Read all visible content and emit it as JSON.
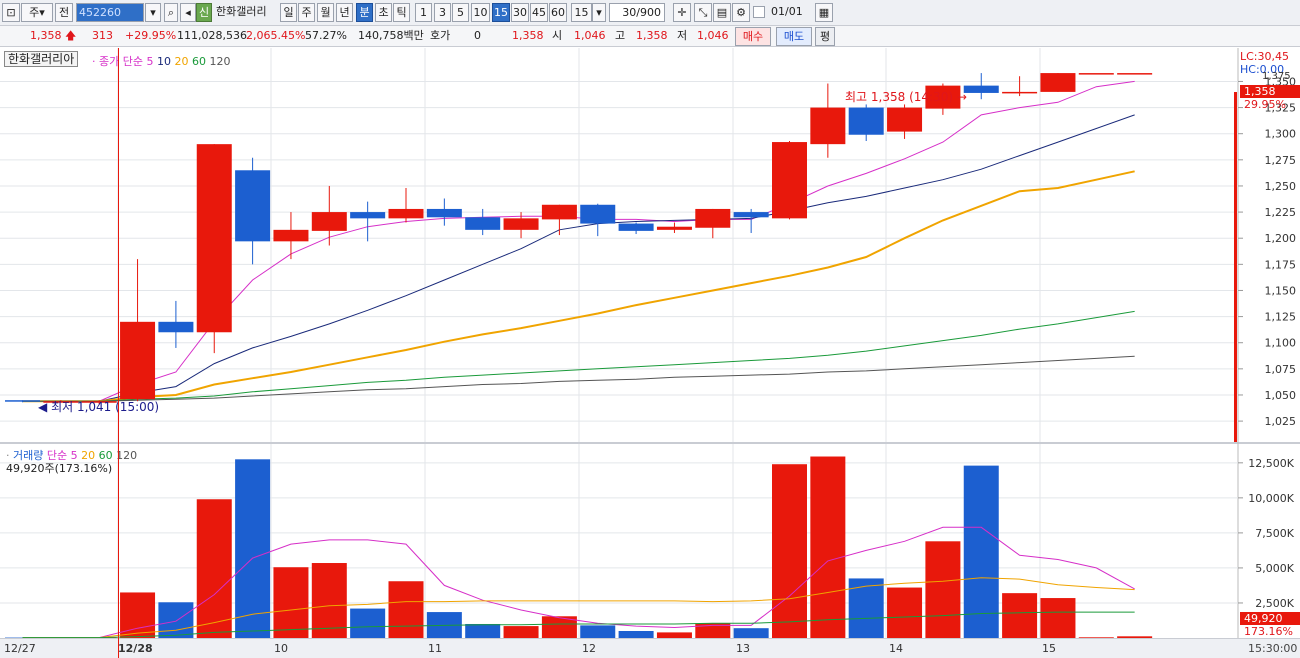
{
  "toolbar": {
    "market_label": "주",
    "prev_label": "전",
    "code": "452260",
    "credit_badge": "신",
    "stock_name": "한화갤러리",
    "period_buttons": [
      "일",
      "주",
      "월",
      "년",
      "분",
      "초",
      "틱"
    ],
    "selected_period": "분",
    "interval_buttons": [
      "1",
      "3",
      "5",
      "10",
      "15",
      "30",
      "45",
      "60"
    ],
    "selected_interval": "15",
    "interval_select": "15",
    "count": "30/900",
    "date_input": "01/01"
  },
  "quote": {
    "price": "1,358",
    "change": "313",
    "change_pct": "+29.95%",
    "volume": "111,028,536",
    "volume_ratio": "2,065.45%",
    "turnover": "57.27%",
    "amount": "140,758백만",
    "hoga_label": "호가",
    "hoga_value": "0",
    "hoga_price": "1,358",
    "open_label": "시",
    "open": "1,046",
    "high_label": "고",
    "high": "1,358",
    "low_label": "저",
    "low": "1,046",
    "buy_button": "매수",
    "sell_button": "매도",
    "eval_button": "평"
  },
  "price_pane": {
    "title": "한화갤러리아",
    "legend_prefix": "종가 단순",
    "ma_labels": [
      "5",
      "10",
      "20",
      "60",
      "120"
    ],
    "lc_label": "LC:30,45",
    "hc_label": "HC:0.00",
    "high_annotation": "최고 1,358 (14:30)",
    "low_annotation": "최저 1,041 (15:00)",
    "current_price_tag": "1,358",
    "current_pct_tag": "29.95%",
    "axis_top_label": "1,375"
  },
  "volume_pane": {
    "title": "거래량",
    "legend_prefix": "단순",
    "ma_labels": [
      "5",
      "20",
      "60",
      "120"
    ],
    "current_volume": "49,920주(173.16%)",
    "current_tag": "49,920",
    "current_pct_tag": "173.16%"
  },
  "time_axis": {
    "labels": [
      "12/27",
      "12/28",
      "10",
      "11",
      "12",
      "13",
      "14",
      "15"
    ],
    "clock": "15:30:00"
  },
  "colors": {
    "up": "#e8180c",
    "down": "#1c5fd0",
    "ma5": "#d62fc8",
    "ma10": "#1a2a7a",
    "ma20": "#f0a400",
    "ma60": "#1a9a3a",
    "ma120": "#555555",
    "vol_ma5": "#d62fc8",
    "vol_ma20": "#f0a400",
    "vol_ma60": "#1a9a3a"
  },
  "chart_data": {
    "type": "candlestick",
    "price_axis": {
      "ticks": [
        1025,
        1050,
        1075,
        1100,
        1125,
        1150,
        1175,
        1200,
        1225,
        1250,
        1275,
        1300,
        1325,
        1350
      ],
      "range": [
        1005,
        1382
      ]
    },
    "candles": [
      {
        "o": 1045,
        "h": 1045,
        "l": 1043,
        "c": 1044
      },
      {
        "o": 1044,
        "h": 1045,
        "l": 1043,
        "c": 1044
      },
      {
        "o": 1044,
        "h": 1045,
        "l": 1041,
        "c": 1044
      },
      {
        "o": 1046,
        "h": 1180,
        "l": 1044,
        "c": 1120
      },
      {
        "o": 1120,
        "h": 1140,
        "l": 1095,
        "c": 1110
      },
      {
        "o": 1110,
        "h": 1290,
        "l": 1090,
        "c": 1290
      },
      {
        "o": 1265,
        "h": 1277,
        "l": 1175,
        "c": 1197
      },
      {
        "o": 1197,
        "h": 1225,
        "l": 1180,
        "c": 1208
      },
      {
        "o": 1207,
        "h": 1250,
        "l": 1193,
        "c": 1225
      },
      {
        "o": 1225,
        "h": 1235,
        "l": 1197,
        "c": 1219
      },
      {
        "o": 1219,
        "h": 1248,
        "l": 1215,
        "c": 1228
      },
      {
        "o": 1228,
        "h": 1238,
        "l": 1212,
        "c": 1220
      },
      {
        "o": 1220,
        "h": 1228,
        "l": 1203,
        "c": 1208
      },
      {
        "o": 1208,
        "h": 1225,
        "l": 1200,
        "c": 1219
      },
      {
        "o": 1218,
        "h": 1232,
        "l": 1203,
        "c": 1232
      },
      {
        "o": 1232,
        "h": 1233,
        "l": 1202,
        "c": 1214
      },
      {
        "o": 1214,
        "h": 1215,
        "l": 1204,
        "c": 1207
      },
      {
        "o": 1208,
        "h": 1215,
        "l": 1205,
        "c": 1211
      },
      {
        "o": 1210,
        "h": 1228,
        "l": 1200,
        "c": 1228
      },
      {
        "o": 1225,
        "h": 1228,
        "l": 1205,
        "c": 1220
      },
      {
        "o": 1219,
        "h": 1293,
        "l": 1218,
        "c": 1292
      },
      {
        "o": 1290,
        "h": 1348,
        "l": 1277,
        "c": 1325
      },
      {
        "o": 1325,
        "h": 1328,
        "l": 1293,
        "c": 1299
      },
      {
        "o": 1302,
        "h": 1328,
        "l": 1295,
        "c": 1325
      },
      {
        "o": 1324,
        "h": 1348,
        "l": 1318,
        "c": 1346
      },
      {
        "o": 1346,
        "h": 1358,
        "l": 1333,
        "c": 1339
      },
      {
        "o": 1340,
        "h": 1355,
        "l": 1336,
        "c": 1340
      },
      {
        "o": 1340,
        "h": 1358,
        "l": 1340,
        "c": 1358
      },
      {
        "o": 1358,
        "h": 1358,
        "l": 1358,
        "c": 1358
      },
      {
        "o": 1358,
        "h": 1358,
        "l": 1358,
        "c": 1358
      }
    ],
    "ma_series": [
      {
        "name": "5",
        "values": [
          1044,
          1044,
          1044,
          1060,
          1072,
          1120,
          1160,
          1185,
          1201,
          1211,
          1216,
          1219,
          1220,
          1221,
          1221,
          1218,
          1218,
          1216,
          1218,
          1218,
          1233,
          1250,
          1262,
          1276,
          1292,
          1318,
          1325,
          1330,
          1345,
          1350
        ]
      },
      {
        "name": "10",
        "values": [
          1044,
          1044,
          1044,
          1052,
          1058,
          1080,
          1095,
          1106,
          1118,
          1131,
          1145,
          1160,
          1175,
          1190,
          1208,
          1214,
          1216,
          1217,
          1218,
          1219,
          1226,
          1234,
          1240,
          1248,
          1256,
          1266,
          1279,
          1292,
          1305,
          1318
        ]
      },
      {
        "name": "20",
        "values": [
          1044,
          1044,
          1044,
          1048,
          1050,
          1060,
          1066,
          1072,
          1079,
          1086,
          1093,
          1101,
          1108,
          1114,
          1121,
          1128,
          1136,
          1143,
          1150,
          1157,
          1164,
          1172,
          1182,
          1200,
          1217,
          1231,
          1245,
          1248,
          1256,
          1264,
          1275
        ]
      },
      {
        "name": "60",
        "values": [
          1044,
          1044,
          1044,
          1046,
          1047,
          1049,
          1053,
          1056,
          1059,
          1062,
          1064,
          1067,
          1069,
          1071,
          1073,
          1075,
          1077,
          1079,
          1081,
          1083,
          1085,
          1088,
          1092,
          1097,
          1102,
          1107,
          1113,
          1118,
          1124,
          1130,
          1136
        ]
      },
      {
        "name": "120",
        "values": [
          1044,
          1044,
          1044,
          1045,
          1046,
          1047,
          1049,
          1051,
          1053,
          1055,
          1056,
          1058,
          1060,
          1061,
          1063,
          1064,
          1065,
          1067,
          1068,
          1069,
          1070,
          1072,
          1073,
          1075,
          1077,
          1079,
          1081,
          1083,
          1085,
          1087,
          1089
        ]
      }
    ],
    "volume_axis": {
      "ticks": [
        2500,
        5000,
        7500,
        10000,
        12500
      ],
      "tick_labels": [
        "2,500K",
        "5,000K",
        "7,500K",
        "10,000K",
        "12,500K"
      ],
      "range": [
        0,
        13700
      ]
    },
    "volume": [
      30,
      30,
      30,
      3250,
      2550,
      9900,
      12750,
      5050,
      5350,
      2100,
      4050,
      1850,
      1000,
      850,
      1550,
      900,
      500,
      400,
      1050,
      700,
      12400,
      12950,
      4250,
      3600,
      6900,
      12300,
      3200,
      2850,
      50,
      120
    ],
    "volume_ma": [
      {
        "name": "5",
        "values": [
          30,
          30,
          30,
          700,
          1200,
          3100,
          5700,
          6700,
          7000,
          7000,
          6700,
          3750,
          2700,
          2000,
          1450,
          1050,
          850,
          750,
          900,
          900,
          3000,
          5500,
          6250,
          6900,
          7900,
          7900,
          5900,
          5600,
          5000,
          3500
        ]
      },
      {
        "name": "20",
        "values": [
          30,
          30,
          30,
          350,
          550,
          1100,
          1700,
          2000,
          2300,
          2400,
          2600,
          2600,
          2650,
          2650,
          2650,
          2650,
          2650,
          2650,
          2600,
          2650,
          2800,
          3250,
          3700,
          3900,
          4050,
          4300,
          4200,
          3800,
          3600,
          3450
        ]
      },
      {
        "name": "60",
        "values": [
          30,
          30,
          30,
          100,
          200,
          400,
          500,
          600,
          700,
          800,
          850,
          900,
          950,
          950,
          1000,
          1000,
          1000,
          1000,
          1050,
          1050,
          1150,
          1300,
          1400,
          1500,
          1600,
          1750,
          1800,
          1850,
          1850,
          1850
        ]
      }
    ]
  }
}
